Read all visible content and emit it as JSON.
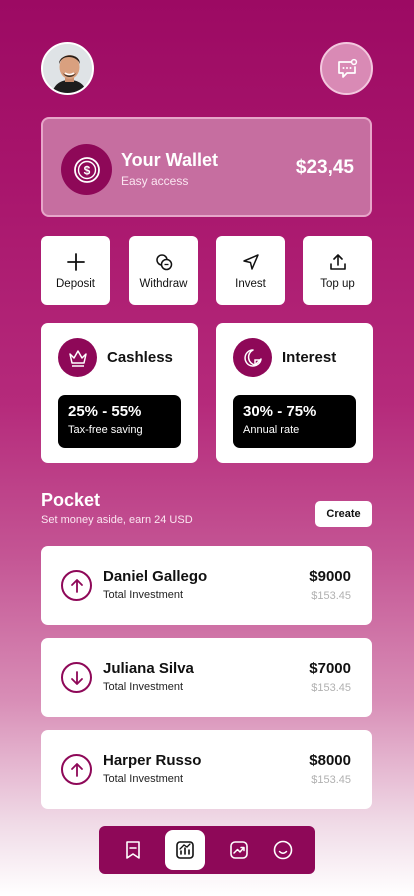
{
  "header": {
    "avatar_icon": "user-avatar",
    "message_icon": "chat-dots-icon"
  },
  "wallet": {
    "title": "Your Wallet",
    "subtitle": "Easy access",
    "amount": "$23,45",
    "icon": "dollar-coin-icon"
  },
  "actions": [
    {
      "label": "Deposit",
      "icon": "plus-icon"
    },
    {
      "label": "Withdraw",
      "icon": "coins-icon"
    },
    {
      "label": "Invest",
      "icon": "send-icon"
    },
    {
      "label": "Top up",
      "icon": "upload-icon"
    }
  ],
  "features": [
    {
      "title": "Cashless",
      "value": "25% - 55%",
      "label": "Tax-free saving",
      "icon": "crown-icon"
    },
    {
      "title": "Interest",
      "value": "30% - 75%",
      "label": "Annual rate",
      "icon": "sticker-icon"
    }
  ],
  "pocket": {
    "title": "Pocket",
    "subtitle": "Set money aside, earn 24 USD",
    "create_label": "Create"
  },
  "investments": [
    {
      "name": "Daniel Gallego",
      "label": "Total Investment",
      "amount": "$9000",
      "sub_amount": "$153.45",
      "direction": "up"
    },
    {
      "name": "Juliana Silva",
      "label": "Total Investment",
      "amount": "$7000",
      "sub_amount": "$153.45",
      "direction": "down"
    },
    {
      "name": "Harper Russo",
      "label": "Total Investment",
      "amount": "$8000",
      "sub_amount": "$153.45",
      "direction": "up"
    }
  ],
  "nav": {
    "items": [
      "bookmark-icon",
      "chart-icon",
      "trend-icon",
      "smile-icon"
    ],
    "active_index": 1
  },
  "colors": {
    "brand": "#8e0858",
    "card": "#ffffff",
    "pill": "#000000"
  }
}
